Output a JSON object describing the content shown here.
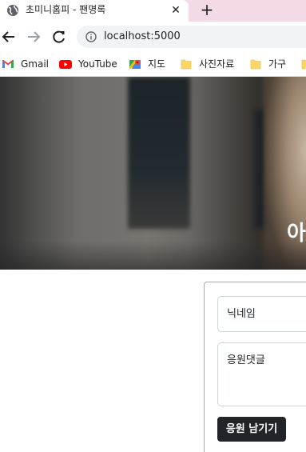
{
  "browser": {
    "tab": {
      "title": "초미니홈피 - 팬명록",
      "favicon": "globe-icon",
      "close_label": "✕"
    },
    "new_tab_label": "+",
    "toolbar": {
      "url": "localhost:5000",
      "site_info_icon": "info-icon"
    },
    "bookmarks": [
      {
        "label": "Gmail",
        "icon": "gmail-icon"
      },
      {
        "label": "YouTube",
        "icon": "youtube-icon"
      },
      {
        "label": "지도",
        "icon": "maps-icon"
      },
      {
        "label": "사진자료",
        "icon": "folder-icon"
      },
      {
        "label": "가구",
        "icon": "folder-icon"
      }
    ],
    "colors": {
      "tabstrip": "#f4d9e6",
      "omnibox": "#f1f3f4"
    }
  },
  "hero": {
    "heading": "아"
  },
  "form": {
    "nickname_placeholder": "닉네임",
    "comment_placeholder": "응원댓글",
    "submit_label": "응원 남기기",
    "colors": {
      "button": "#212529",
      "input_border": "#ced4da"
    }
  }
}
